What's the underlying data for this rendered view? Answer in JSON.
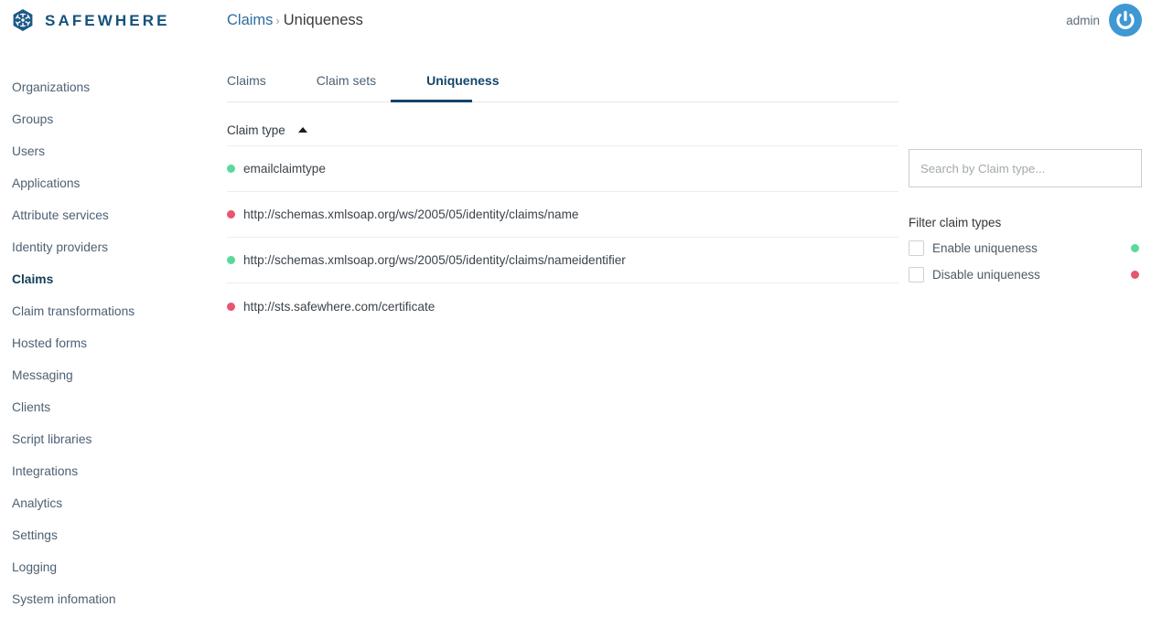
{
  "header": {
    "brand_name": "SAFEWHERE",
    "brand_icon": "safewhere-hex-logo-icon",
    "breadcrumb": {
      "parent": "Claims",
      "separator": "›",
      "current": "Uniqueness"
    },
    "user_name": "admin",
    "avatar_icon": "power-avatar-icon"
  },
  "sidebar": {
    "items": [
      {
        "label": "Organizations",
        "active": false
      },
      {
        "label": "Groups",
        "active": false
      },
      {
        "label": "Users",
        "active": false
      },
      {
        "label": "Applications",
        "active": false
      },
      {
        "label": "Attribute services",
        "active": false
      },
      {
        "label": "Identity providers",
        "active": false
      },
      {
        "label": "Claims",
        "active": true
      },
      {
        "label": "Claim transformations",
        "active": false
      },
      {
        "label": "Hosted forms",
        "active": false
      },
      {
        "label": "Messaging",
        "active": false
      },
      {
        "label": "Clients",
        "active": false
      },
      {
        "label": "Script libraries",
        "active": false
      },
      {
        "label": "Integrations",
        "active": false
      },
      {
        "label": "Analytics",
        "active": false
      },
      {
        "label": "Settings",
        "active": false
      },
      {
        "label": "Logging",
        "active": false
      },
      {
        "label": "System infomation",
        "active": false
      }
    ]
  },
  "main": {
    "tabs": [
      {
        "label": "Claims",
        "active": false
      },
      {
        "label": "Claim sets",
        "active": false
      },
      {
        "label": "Uniqueness",
        "active": true
      }
    ],
    "table": {
      "column_header": "Claim type",
      "sort_direction": "ascending",
      "sort_icon": "sort-ascending-arrow-icon",
      "rows": [
        {
          "claim_type": "emailclaimtype",
          "status": "enabled",
          "dot_color": "#5bd99a"
        },
        {
          "claim_type": "http://schemas.xmlsoap.org/ws/2005/05/identity/claims/name",
          "status": "disabled",
          "dot_color": "#e8556e"
        },
        {
          "claim_type": "http://schemas.xmlsoap.org/ws/2005/05/identity/claims/nameidentifier",
          "status": "enabled",
          "dot_color": "#5bd99a"
        },
        {
          "claim_type": "http://sts.safewhere.com/certificate",
          "status": "disabled",
          "dot_color": "#e8556e"
        }
      ]
    }
  },
  "right_panel": {
    "search": {
      "value": "",
      "placeholder": "Search by Claim type..."
    },
    "filter_title": "Filter claim types",
    "filters": [
      {
        "label": "Enable uniqueness",
        "checked": false,
        "dot_color": "#5bd99a"
      },
      {
        "label": "Disable uniqueness",
        "checked": false,
        "dot_color": "#e8556e"
      }
    ]
  },
  "colors": {
    "brand_blue": "#14527c",
    "link_blue": "#2d6ca2",
    "active_navy": "#14456b",
    "status_green": "#5bd99a",
    "status_red": "#e8556e",
    "avatar_blue": "#3f97d3"
  }
}
